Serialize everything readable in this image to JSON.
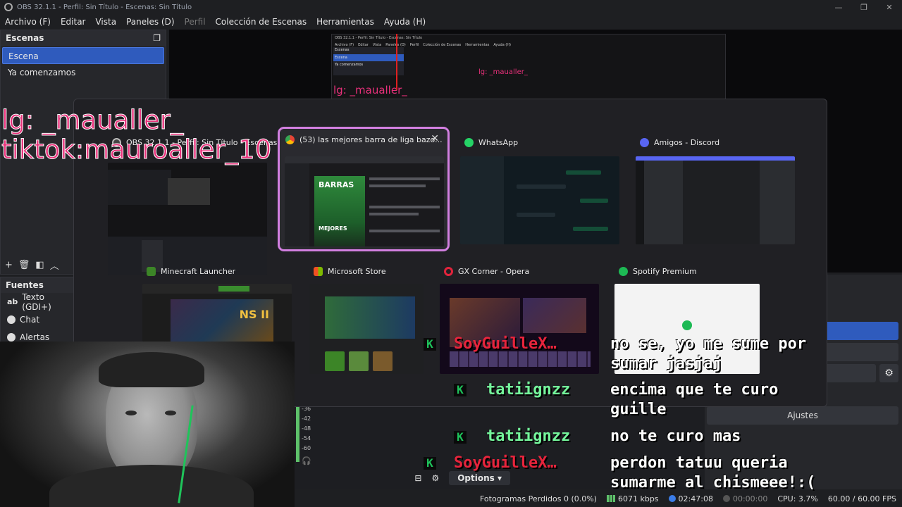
{
  "titlebar": {
    "title": "OBS 32.1.1 - Perfil: Sin Título - Escenas: Sin Título",
    "controls": [
      "—",
      "❐",
      "✕"
    ]
  },
  "menu": [
    {
      "label": "Archivo (F)",
      "disabled": false
    },
    {
      "label": "Editar",
      "disabled": false
    },
    {
      "label": "Vista",
      "disabled": false
    },
    {
      "label": "Paneles (D)",
      "disabled": false
    },
    {
      "label": "Perfil",
      "disabled": true
    },
    {
      "label": "Colección de Escenas",
      "disabled": false
    },
    {
      "label": "Herramientas",
      "disabled": false
    },
    {
      "label": "Ayuda (H)",
      "disabled": false
    }
  ],
  "scenes": {
    "header": "Escenas",
    "items": [
      "Escena",
      "Ya comenzamos"
    ],
    "active_index": 0
  },
  "sources": {
    "header": "Fuentes",
    "items": [
      {
        "label": "Texto (GDI+)",
        "icon": "text-icon"
      },
      {
        "label": "Chat",
        "icon": "globe-icon"
      },
      {
        "label": "Alertas",
        "icon": "globe-icon"
      }
    ]
  },
  "preview_text": {
    "ig": "lg: _maualler_",
    "tiktok": "tiktok:mauroaller_10"
  },
  "mini_obs": {
    "title": "OBS 32.1.1 - Perfil: Sin Título - Escenas: Sin Título",
    "menu": [
      "Archivo (F)",
      "Editar",
      "Vista",
      "Paneles (D)",
      "Perfil",
      "Colección de Escenas",
      "Herramientas",
      "Ayuda (H)"
    ],
    "scene_header": "Escenas",
    "scenes": [
      "Escena",
      "Ya comenzamos"
    ],
    "ig": "lg: _maualler_"
  },
  "alttab": {
    "windows": [
      {
        "title": "OBS 32.1.1 - Perfil: Sin Título - Escenas: Sin Tí...",
        "icon": "obs-icon"
      },
      {
        "title": "(53) las mejores barra de liga bazo...",
        "icon": "chrome-icon",
        "selected": true
      },
      {
        "title": "WhatsApp",
        "icon": "whatsapp-icon"
      },
      {
        "title": "Amigos - Discord",
        "icon": "discord-icon"
      },
      {
        "title": "Minecraft Launcher",
        "icon": "minecraft-icon"
      },
      {
        "title": "Microsoft Store",
        "icon": "store-icon"
      },
      {
        "title": "GX Corner - Opera",
        "icon": "opera-icon"
      },
      {
        "title": "Spotify Premium",
        "icon": "spotify-icon"
      }
    ],
    "chrome_thumb": {
      "hero_top": "BARRAS",
      "hero_bottom": "MEJORES"
    },
    "minecraft_thumb": {
      "banner": "NS II"
    }
  },
  "controls": {
    "buttons": [
      "Ajustes"
    ]
  },
  "mixer": {
    "db_labels": [
      "-36",
      "-42",
      "-48",
      "-54",
      "-60"
    ],
    "options_label": "Options"
  },
  "status": {
    "frames_dropped": "Fotogramas Perdidos 0 (0.0%)",
    "bitrate": "6071 kbps",
    "live_time": "02:47:08",
    "rec_time": "00:00:00",
    "cpu": "CPU: 3.7%",
    "fps": "60.00 / 60.00 FPS"
  },
  "chat": [
    {
      "user": "SoyGuilleX…",
      "user_color": "#e8243c",
      "message": [
        "no se, yo me sume por",
        "sumar jasjaj"
      ]
    },
    {
      "user": "tatiignzz",
      "user_color": "#74f59b",
      "message": [
        "encima que te curo",
        "guille"
      ]
    },
    {
      "user": "tatiignzz",
      "user_color": "#74f59b",
      "message": [
        "no te curo mas"
      ]
    },
    {
      "user": "SoyGuilleX…",
      "user_color": "#e8243c",
      "message": [
        "perdon tatuu queria",
        "sumarme al chismeee!:("
      ]
    }
  ],
  "chat_badge": "K",
  "colors": {
    "accent": "#2f5bbd",
    "selected_border": "#d27fe0",
    "ig_pink": "#e8307a",
    "meter_green": "#5ec16a"
  }
}
